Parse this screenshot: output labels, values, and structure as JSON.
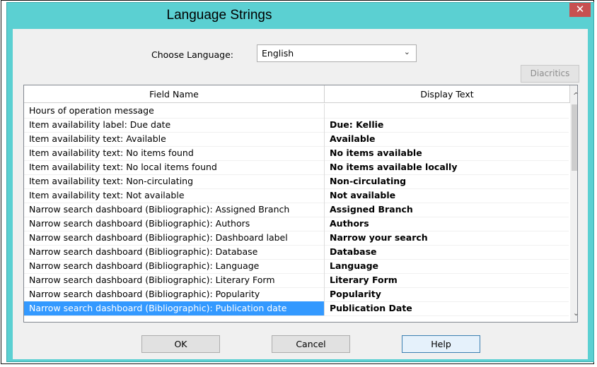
{
  "window": {
    "title": "Language Strings",
    "close_glyph": "✕"
  },
  "language": {
    "label": "Choose Language:",
    "selected": "English",
    "arrow_glyph": "⌄"
  },
  "toolbar": {
    "diacritics_label": "Diacritics"
  },
  "grid": {
    "columns": [
      "Field Name",
      "Display Text"
    ],
    "rows": [
      {
        "field": "Hours of operation message",
        "display": ""
      },
      {
        "field": "Item availability label: Due date",
        "display": "Due: Kellie"
      },
      {
        "field": "Item availability text: Available",
        "display": "Available"
      },
      {
        "field": "Item availability text: No items found",
        "display": "No items available"
      },
      {
        "field": "Item availability text: No local items found",
        "display": "No items available locally"
      },
      {
        "field": "Item availability text: Non-circulating",
        "display": "Non-circulating"
      },
      {
        "field": "Item availability text: Not available",
        "display": "Not available"
      },
      {
        "field": "Narrow search dashboard (Bibliographic): Assigned Branch",
        "display": "Assigned Branch"
      },
      {
        "field": "Narrow search dashboard (Bibliographic): Authors",
        "display": "Authors"
      },
      {
        "field": "Narrow search dashboard (Bibliographic): Dashboard label",
        "display": "Narrow your search"
      },
      {
        "field": "Narrow search dashboard (Bibliographic): Database",
        "display": "Database"
      },
      {
        "field": "Narrow search dashboard (Bibliographic): Language",
        "display": "Language"
      },
      {
        "field": "Narrow search dashboard (Bibliographic): Literary Form",
        "display": "Literary Form"
      },
      {
        "field": "Narrow search dashboard (Bibliographic): Popularity",
        "display": "Popularity"
      },
      {
        "field": "Narrow search dashboard (Bibliographic): Publication date",
        "display": "Publication Date"
      }
    ],
    "selected_index": 14,
    "scroll_up_glyph": "^",
    "scroll_down_glyph": "⌄"
  },
  "buttons": {
    "ok": "OK",
    "cancel": "Cancel",
    "help": "Help"
  },
  "colors": {
    "titlebar": "#5bd0d2",
    "selection": "#3399ff",
    "close": "#c75050"
  }
}
